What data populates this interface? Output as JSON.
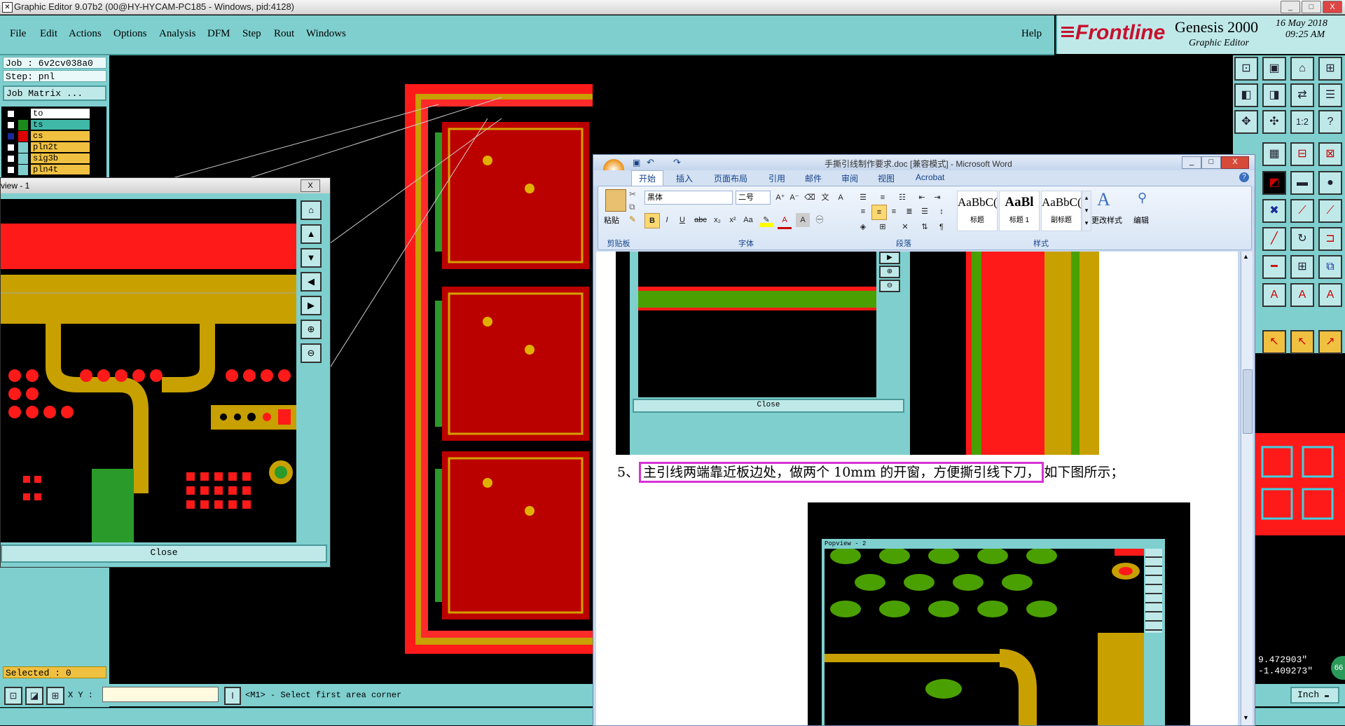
{
  "app": {
    "title": "Graphic Editor 9.07b2 (00@HY-HYCAM-PC185 - Windows, pid:4128)",
    "window_buttons": [
      "_",
      "□",
      "X"
    ]
  },
  "menu": {
    "items": [
      "File",
      "Edit",
      "Actions",
      "Options",
      "Analysis",
      "DFM",
      "Step",
      "Rout",
      "Windows"
    ],
    "help": "Help"
  },
  "brand": {
    "logo": "Frontline",
    "product": "Genesis 2000",
    "subtitle": "Graphic Editor",
    "date": "16 May 2018",
    "time": "09:25 AM"
  },
  "job": {
    "job_line": "Job : 6v2cv038a0",
    "step_line": "Step: pnl",
    "matrix_button": "Job Matrix ..."
  },
  "layers": [
    {
      "name": "to",
      "swatch": "#000000",
      "bg": "#ffffff"
    },
    {
      "name": "ts",
      "swatch": "#1a8a1a",
      "bg": "#3fb8a8"
    },
    {
      "name": "cs",
      "swatch": "#dd0000",
      "bg": "#f0c040"
    },
    {
      "name": "pln2t",
      "swatch": "#7fcfcf",
      "bg": "#f0c040"
    },
    {
      "name": "sig3b",
      "swatch": "#7fcfcf",
      "bg": "#f0c040"
    },
    {
      "name": "pln4t",
      "swatch": "#7fcfcf",
      "bg": "#f0c040"
    }
  ],
  "status": {
    "selected": "Selected : 0",
    "xy_label": "X Y :",
    "prompt": "<M1> - Select first area corner",
    "coord_x": "9.472903\"",
    "coord_y": "-1.409273\"",
    "units": "Inch",
    "badge": "66"
  },
  "popview": {
    "title": "view - 1",
    "close": "Close",
    "close_x": "X"
  },
  "word": {
    "title": "手撕引线制作要求.doc [兼容模式] - Microsoft Word",
    "tabs": [
      "开始",
      "插入",
      "页面布局",
      "引用",
      "邮件",
      "审阅",
      "视图",
      "Acrobat"
    ],
    "font_name": "黑体",
    "font_size": "二号",
    "groups": [
      "剪贴板",
      "字体",
      "段落",
      "样式",
      "编辑"
    ],
    "paste": "粘贴",
    "styles": [
      {
        "preview": "AaBbC(",
        "name": "标题"
      },
      {
        "preview": "AaBl",
        "name": "标题 1"
      },
      {
        "preview": "AaBbC(",
        "name": "副标题"
      }
    ],
    "change_styles": "更改样式",
    "edit": "编辑",
    "doc_text_prefix": "5、",
    "doc_text_highlight": "主引线两端靠近板边处，做两个 10mm 的开窗，方便撕引线下刀，",
    "doc_text_suffix": "如下图所示；",
    "inner_close": "Close",
    "inner_popview": "Popview - 2"
  }
}
